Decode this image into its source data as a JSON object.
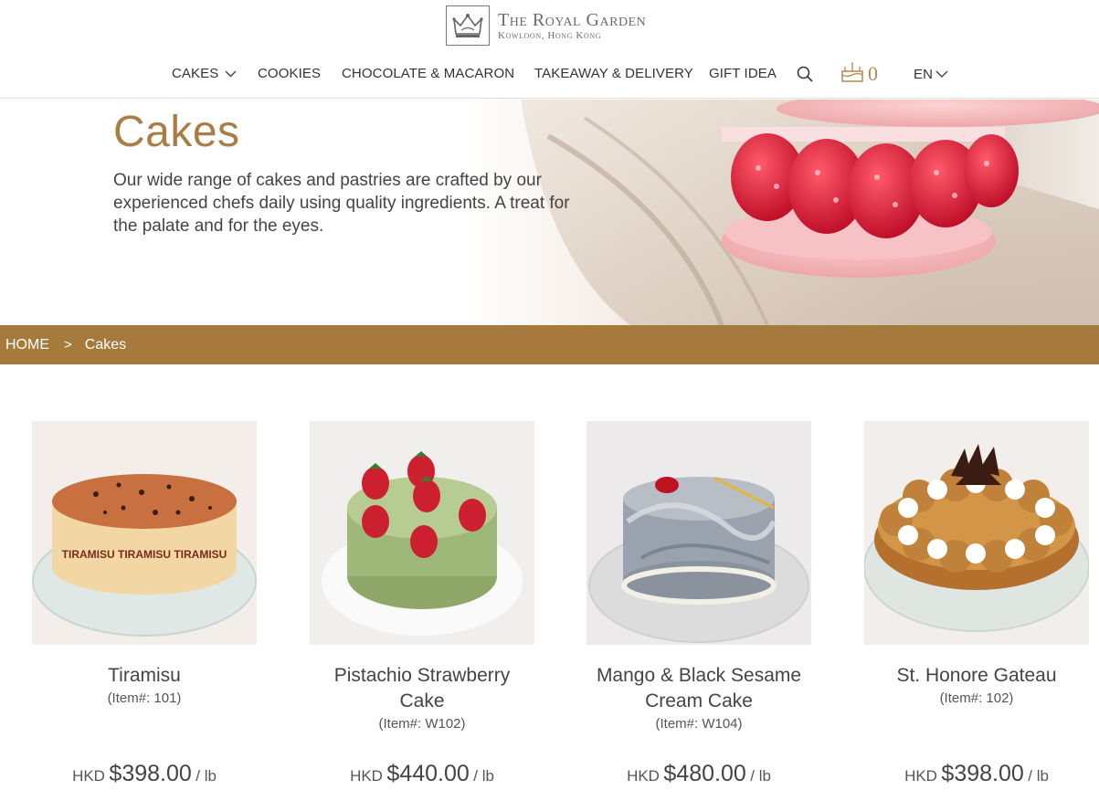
{
  "brand": {
    "name": "The Royal Garden",
    "location": "Kowloon, Hong Kong"
  },
  "nav": {
    "items": [
      {
        "label": "CAKES",
        "has_dropdown": true
      },
      {
        "label": "COOKIES"
      },
      {
        "label": "CHOCOLATE & MACARON"
      },
      {
        "label": "TAKEAWAY & DELIVERY"
      },
      {
        "label": "GIFT IDEA"
      }
    ],
    "cart_count": "0",
    "language": "EN",
    "icons": [
      "search-icon",
      "cake-cart-icon",
      "chevron-down-icon"
    ]
  },
  "hero": {
    "title": "Cakes",
    "description": "Our wide range of cakes and pastries are crafted by our experienced chefs daily using quality ingredients. A treat for the palate and for the eyes."
  },
  "breadcrumb": {
    "home": "HOME",
    "separator": ">",
    "current": "Cakes"
  },
  "products": [
    {
      "name": "Tiramisu",
      "item": "(Item#: 101)",
      "currency": "HKD",
      "price": "$398.00",
      "unit": "/ lb"
    },
    {
      "name": "Pistachio Strawberry Cake",
      "item": "(Item#: W102)",
      "currency": "HKD",
      "price": "$440.00",
      "unit": "/ lb"
    },
    {
      "name": "Mango & Black Sesame Cream Cake",
      "item": "(Item#: W104)",
      "currency": "HKD",
      "price": "$480.00",
      "unit": "/ lb"
    },
    {
      "name": "St. Honore Gateau",
      "item": "(Item#: 102)",
      "currency": "HKD",
      "price": "$398.00",
      "unit": "/ lb"
    }
  ],
  "colors": {
    "accent_gold": "#a97d45",
    "breadcrumb_bar": "#a57a3c",
    "text": "#444444"
  }
}
